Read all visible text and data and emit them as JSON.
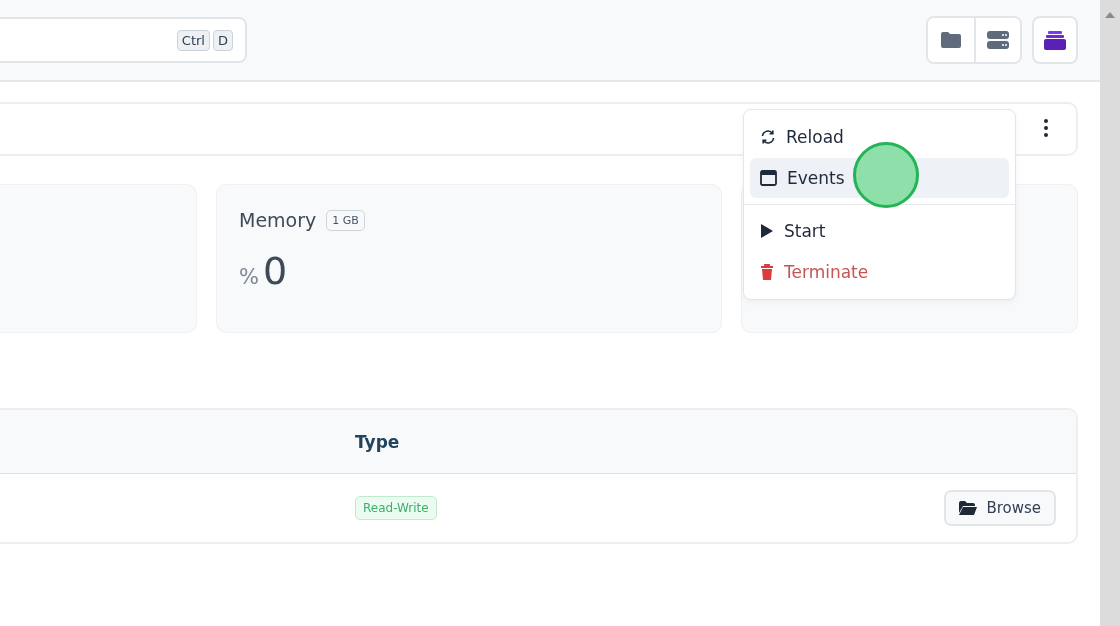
{
  "search": {
    "shortcut_keys": [
      "Ctrl",
      "D"
    ]
  },
  "stats": [
    {
      "title": "Memory",
      "badge": "1 GB",
      "unit": "%",
      "value": "0"
    }
  ],
  "table": {
    "columns": [
      "Type"
    ],
    "rows": [
      {
        "type": "Read-Write",
        "action": "Browse"
      }
    ]
  },
  "menu": {
    "groups": [
      [
        {
          "label": "Reload",
          "kind": "reload",
          "selected": false
        },
        {
          "label": "Events",
          "kind": "window",
          "selected": true
        }
      ],
      [
        {
          "label": "Start",
          "kind": "play",
          "selected": false
        },
        {
          "label": "Terminate",
          "kind": "delete",
          "selected": false
        }
      ]
    ]
  }
}
